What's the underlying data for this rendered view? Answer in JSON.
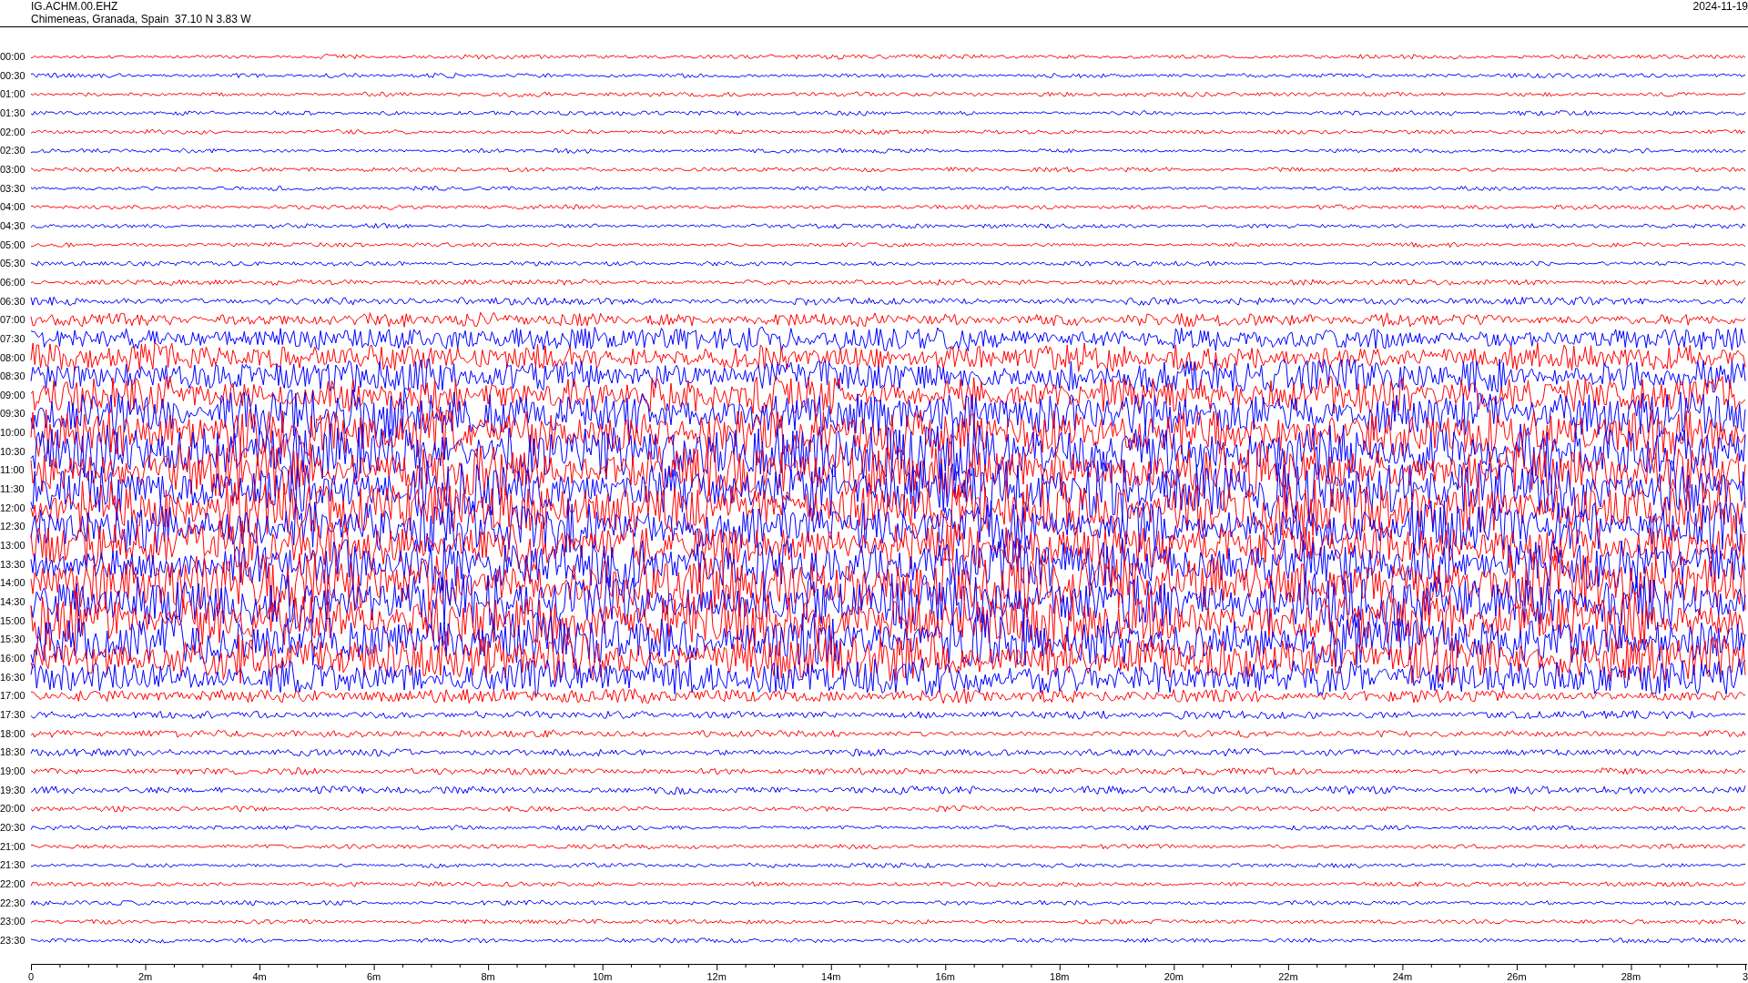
{
  "header": {
    "station": "IG.ACHM.00.EHZ",
    "location": "Chimeneas, Granada, Spain  37.10 N 3.83 W",
    "date": "2024-11-19"
  },
  "traces": [
    {
      "time": "00:00",
      "color": "#ff0000"
    },
    {
      "time": "00:30",
      "color": "#0000ff"
    },
    {
      "time": "01:00",
      "color": "#ff0000"
    },
    {
      "time": "01:30",
      "color": "#0000ff"
    },
    {
      "time": "02:00",
      "color": "#ff0000"
    },
    {
      "time": "02:30",
      "color": "#0000ff"
    },
    {
      "time": "03:00",
      "color": "#ff0000"
    },
    {
      "time": "03:30",
      "color": "#0000ff"
    },
    {
      "time": "04:00",
      "color": "#ff0000"
    },
    {
      "time": "04:30",
      "color": "#0000ff"
    },
    {
      "time": "05:00",
      "color": "#ff0000"
    },
    {
      "time": "05:30",
      "color": "#0000ff"
    },
    {
      "time": "06:00",
      "color": "#ff0000"
    },
    {
      "time": "06:30",
      "color": "#0000ff"
    },
    {
      "time": "07:00",
      "color": "#ff0000"
    },
    {
      "time": "07:30",
      "color": "#0000ff"
    },
    {
      "time": "08:00",
      "color": "#ff0000"
    },
    {
      "time": "08:30",
      "color": "#0000ff"
    },
    {
      "time": "09:00",
      "color": "#ff0000"
    },
    {
      "time": "09:30",
      "color": "#0000ff"
    },
    {
      "time": "10:00",
      "color": "#ff0000"
    },
    {
      "time": "10:30",
      "color": "#0000ff"
    },
    {
      "time": "11:00",
      "color": "#ff0000"
    },
    {
      "time": "11:30",
      "color": "#0000ff"
    },
    {
      "time": "12:00",
      "color": "#ff0000"
    },
    {
      "time": "12:30",
      "color": "#0000ff"
    },
    {
      "time": "13:00",
      "color": "#ff0000"
    },
    {
      "time": "13:30",
      "color": "#0000ff"
    },
    {
      "time": "14:00",
      "color": "#ff0000"
    },
    {
      "time": "14:30",
      "color": "#0000ff"
    },
    {
      "time": "15:00",
      "color": "#ff0000"
    },
    {
      "time": "15:30",
      "color": "#0000ff"
    },
    {
      "time": "16:00",
      "color": "#ff0000"
    },
    {
      "time": "16:30",
      "color": "#0000ff"
    },
    {
      "time": "17:00",
      "color": "#ff0000"
    },
    {
      "time": "17:30",
      "color": "#0000ff"
    },
    {
      "time": "18:00",
      "color": "#ff0000"
    },
    {
      "time": "18:30",
      "color": "#0000ff"
    },
    {
      "time": "19:00",
      "color": "#ff0000"
    },
    {
      "time": "19:30",
      "color": "#0000ff"
    },
    {
      "time": "20:00",
      "color": "#ff0000"
    },
    {
      "time": "20:30",
      "color": "#0000ff"
    },
    {
      "time": "21:00",
      "color": "#ff0000"
    },
    {
      "time": "21:30",
      "color": "#0000ff"
    },
    {
      "time": "22:00",
      "color": "#ff0000"
    },
    {
      "time": "22:30",
      "color": "#0000ff"
    },
    {
      "time": "23:00",
      "color": "#ff0000"
    },
    {
      "time": "23:30",
      "color": "#0000ff"
    }
  ],
  "axis": {
    "ticks": [
      "0",
      "2m",
      "4m",
      "6m",
      "8m",
      "10m",
      "12m",
      "14m",
      "16m",
      "18m",
      "20m",
      "22m",
      "24m",
      "26m",
      "28m",
      "3"
    ]
  }
}
